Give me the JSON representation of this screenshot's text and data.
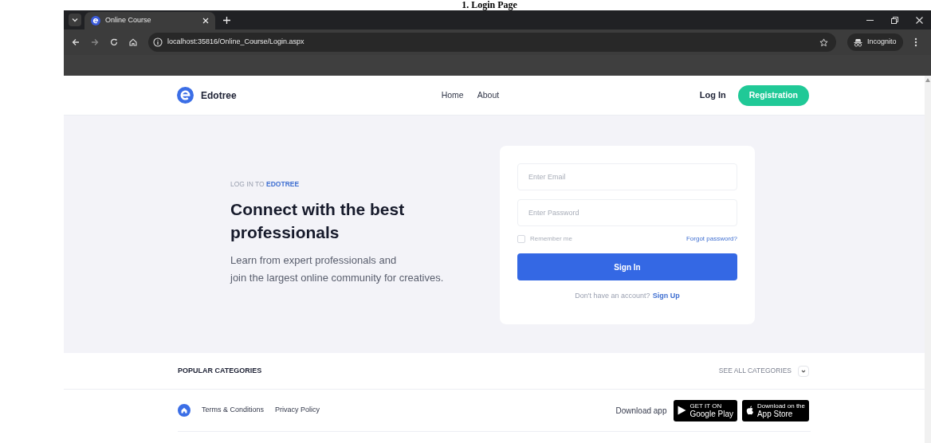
{
  "document_title": "1. Login Page",
  "browser": {
    "tab_title": "Online Course",
    "address": "localhost:35816/Online_Course/Login.aspx",
    "profile": "Incognito"
  },
  "nav": {
    "brand": "Edotree",
    "links": [
      "Home",
      "About"
    ],
    "login": "Log In",
    "register": "Registration"
  },
  "hero": {
    "eyebrow": "LOG IN TO **EDOTREE**",
    "heading": "Connect with the best professionals",
    "lines": [
      "Learn from expert professionals and",
      "join the largest online community for creatives."
    ]
  },
  "form": {
    "email_placeholder": "Enter Email",
    "password_placeholder": "Enter Password",
    "remember": {
      "label": "Remember me",
      "checked": false
    },
    "forgot": "Forgot password?",
    "submit": "Sign In",
    "signup_prompt": "Don't have an account?",
    "signup_link": "Sign Up"
  },
  "categories": {
    "title": "POPULAR CATEGORIES",
    "see_all": "SEE ALL CATEGORIES"
  },
  "footer": {
    "links": [
      "Terms & Conditions",
      "Privacy Policy"
    ],
    "download_label": "Download app",
    "badges": [
      {
        "kind": "google",
        "small": "GET IT ON",
        "big": "Google Play"
      },
      {
        "kind": "apple",
        "small": "Download on the",
        "big": "App Store"
      }
    ]
  }
}
